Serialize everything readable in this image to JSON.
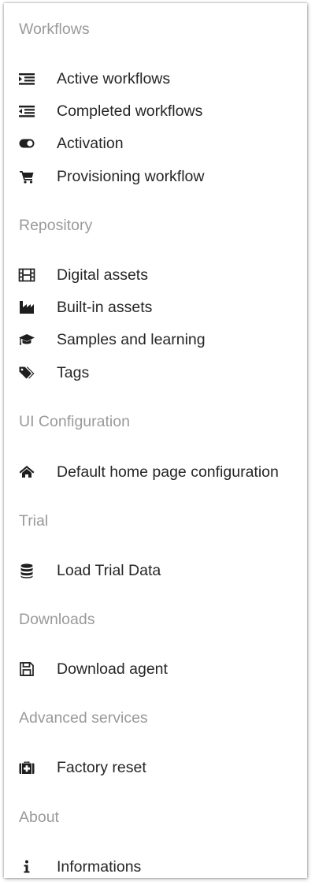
{
  "sections": [
    {
      "title": "Workflows",
      "items": [
        {
          "label": "Active workflows",
          "icon": "indent-list-icon"
        },
        {
          "label": "Completed workflows",
          "icon": "outdent-list-icon"
        },
        {
          "label": "Activation",
          "icon": "toggle-icon"
        },
        {
          "label": "Provisioning workflow",
          "icon": "shopping-cart-icon"
        }
      ]
    },
    {
      "title": "Repository",
      "items": [
        {
          "label": "Digital assets",
          "icon": "film-icon"
        },
        {
          "label": "Built-in assets",
          "icon": "factory-icon"
        },
        {
          "label": "Samples and learning",
          "icon": "graduation-cap-icon"
        },
        {
          "label": "Tags",
          "icon": "tags-icon"
        }
      ]
    },
    {
      "title": "UI Configuration",
      "items": [
        {
          "label": "Default home page configuration",
          "icon": "home-icon"
        }
      ]
    },
    {
      "title": "Trial",
      "items": [
        {
          "label": "Load Trial Data",
          "icon": "database-icon"
        }
      ]
    },
    {
      "title": "Downloads",
      "items": [
        {
          "label": "Download agent",
          "icon": "floppy-disk-icon"
        }
      ]
    },
    {
      "title": "Advanced services",
      "items": [
        {
          "label": "Factory reset",
          "icon": "medkit-icon"
        }
      ]
    },
    {
      "title": "About",
      "items": [
        {
          "label": "Informations",
          "icon": "info-icon"
        }
      ]
    }
  ],
  "colors": {
    "section_title": "#9a9a9a",
    "item_text": "#262626",
    "icon": "#1e1e1e"
  }
}
